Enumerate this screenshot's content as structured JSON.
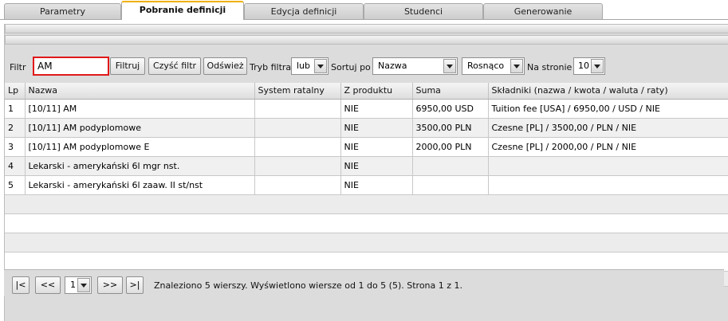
{
  "tabs": [
    {
      "label": "Parametry",
      "active": false
    },
    {
      "label": "Pobranie definicji",
      "active": true
    },
    {
      "label": "Edycja definicji",
      "active": false
    },
    {
      "label": "Studenci",
      "active": false
    },
    {
      "label": "Generowanie",
      "active": false
    }
  ],
  "toolbar": {
    "filter_label": "Filtr",
    "filter_value": "AM",
    "filter_button": "Filtruj",
    "clear_button": "Czyść filtr",
    "refresh_button": "Odśwież",
    "mode_label": "Tryb filtra",
    "mode_value": "lub",
    "sort_label": "Sortuj po",
    "sort_value": "Nazwa",
    "order_value": "Rosnąco",
    "per_page_label": "Na stronie",
    "per_page_value": "10"
  },
  "table": {
    "columns": [
      "Lp",
      "Nazwa",
      "System ratalny",
      "Z produktu",
      "Suma",
      "Składniki (nazwa / kwota / waluta / raty)"
    ],
    "rows": [
      [
        "1",
        "[10/11] AM",
        "",
        "NIE",
        "6950,00 USD",
        "Tuition fee [USA] / 6950,00 / USD / NIE"
      ],
      [
        "2",
        "[10/11] AM podyplomowe",
        "",
        "NIE",
        "3500,00 PLN",
        "Czesne [PL] / 3500,00 / PLN / NIE"
      ],
      [
        "3",
        "[10/11] AM podyplomowe E",
        "",
        "NIE",
        "2000,00 PLN",
        "Czesne [PL] / 2000,00 / PLN / NIE"
      ],
      [
        "4",
        "Lekarski - amerykański 6l mgr nst.",
        "",
        "NIE",
        "",
        ""
      ],
      [
        "5",
        "Lekarski - amerykański 6l zaaw. II st/nst",
        "",
        "NIE",
        "",
        ""
      ]
    ]
  },
  "pager": {
    "first": "|<",
    "prev": "<<",
    "page_value": "1",
    "next": ">>",
    "last": ">|",
    "status": "Znaleziono 5 wierszy. Wyświetlono wiersze od 1 do 5 (5). Strona 1 z 1."
  }
}
